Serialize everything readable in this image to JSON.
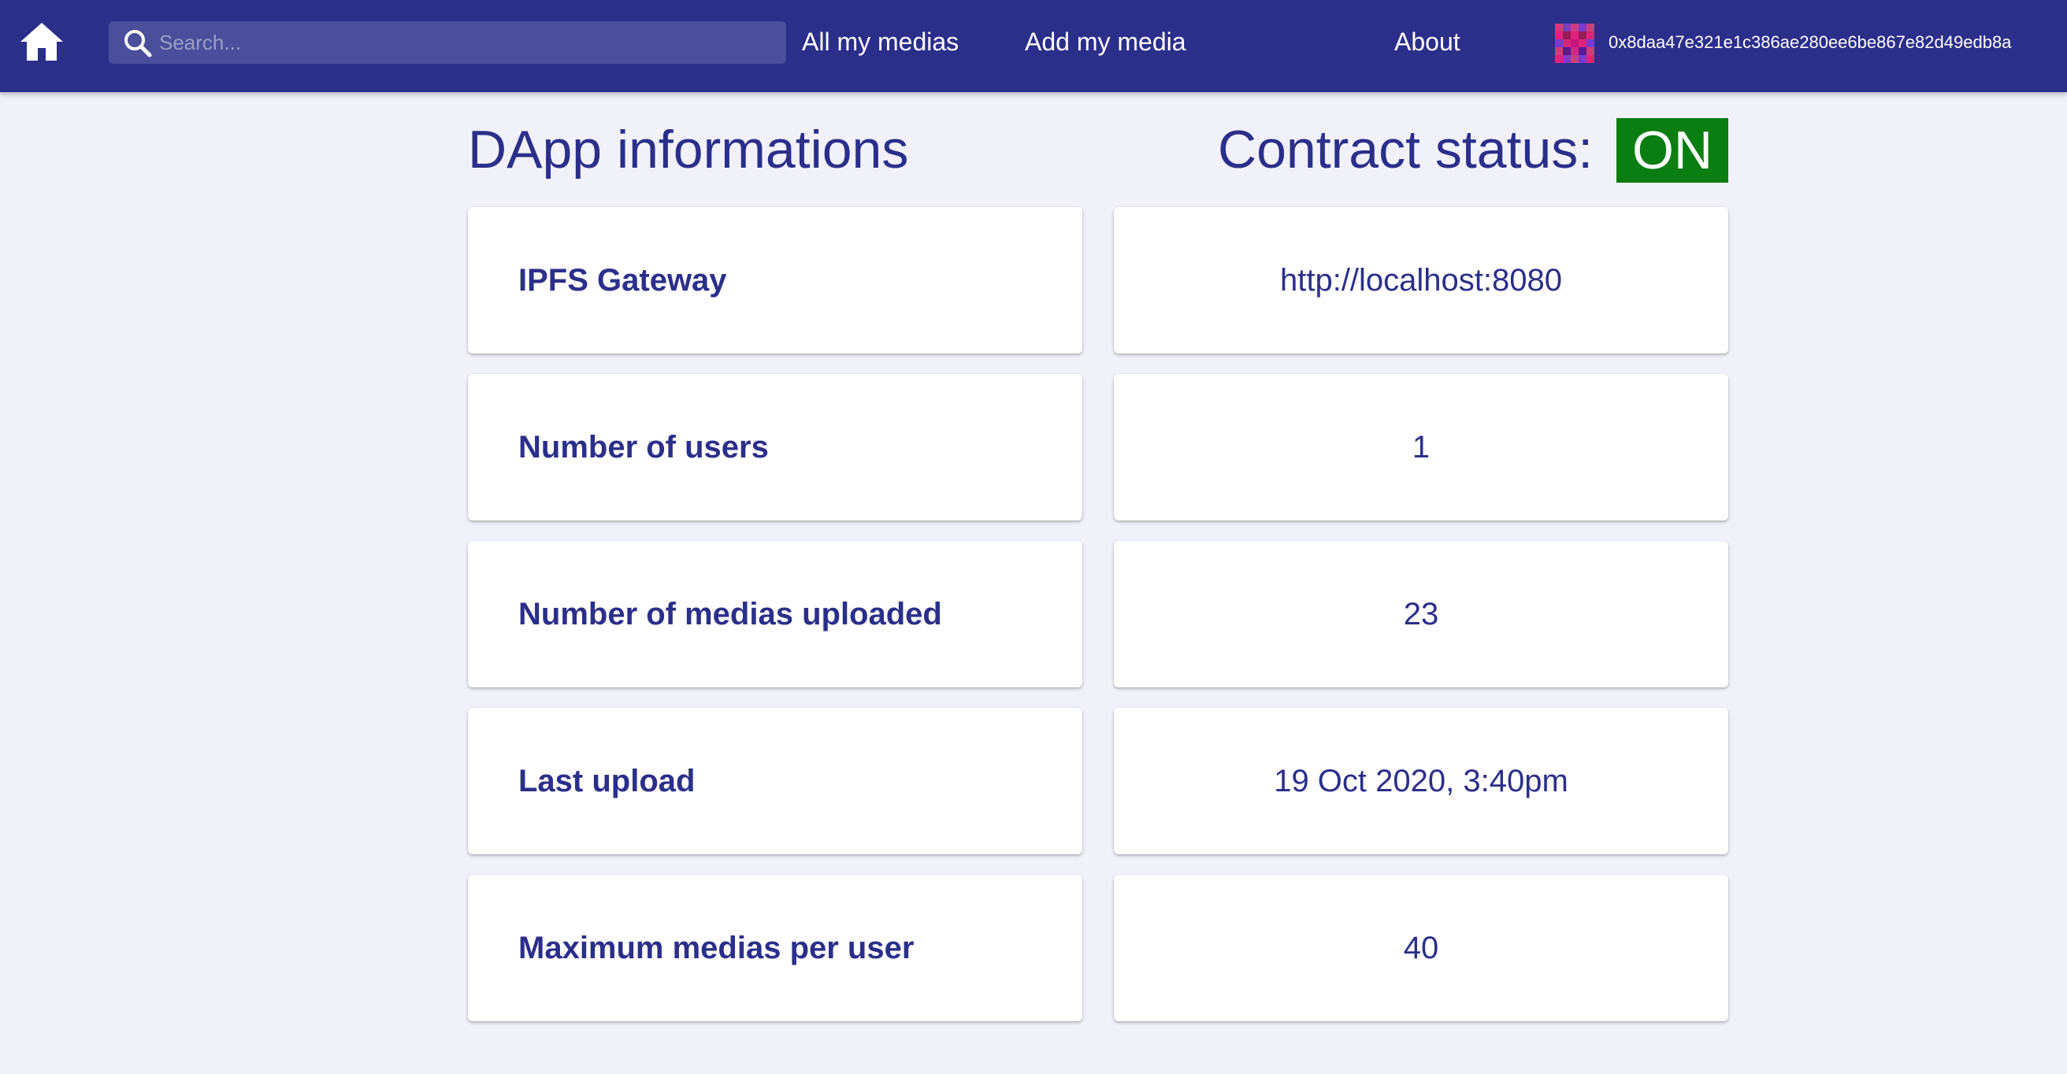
{
  "header": {
    "search_placeholder": "Search...",
    "nav": {
      "all_medias": "All my medias",
      "add_media": "Add my media",
      "about": "About"
    },
    "account_address": "0x8daa47e321e1c386ae280ee6be867e82d49edb8a",
    "bg_color": "#2b2f8a"
  },
  "page": {
    "title": "DApp informations",
    "status_label": "Contract status:",
    "status_value": "ON",
    "status_color": "#0a7e12"
  },
  "info_rows": [
    {
      "label": "IPFS Gateway",
      "value": "http://localhost:8080"
    },
    {
      "label": "Number of users",
      "value": "1"
    },
    {
      "label": "Number of medias uploaded",
      "value": "23"
    },
    {
      "label": "Last upload",
      "value": "19 Oct 2020, 3:40pm"
    },
    {
      "label": "Maximum medias per user",
      "value": "40"
    }
  ],
  "icons": [
    "home-icon",
    "search-icon",
    "identicon-avatar"
  ]
}
